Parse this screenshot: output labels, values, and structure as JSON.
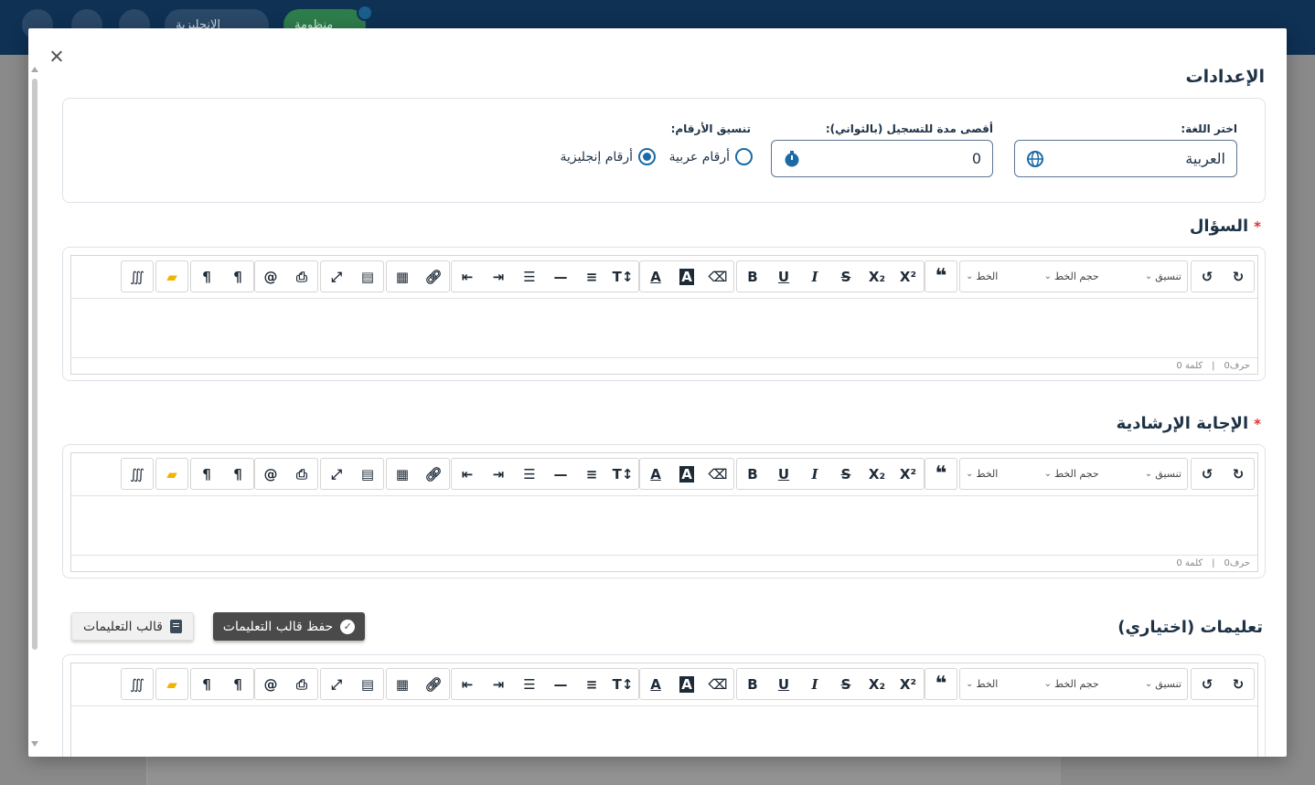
{
  "background": {
    "language_chip": "الإنجليزية",
    "system_chip": "منظومة"
  },
  "modal": {
    "title": "الإعدادات",
    "settings": {
      "language_label": "اختر اللغة:",
      "language_value": "العربية",
      "max_duration_label": "أقصى مدة للتسجيل (بالثواني):",
      "max_duration_value": "0",
      "number_format_label": "تنسيق الأرقام:",
      "number_options": [
        {
          "label": "أرقام عربية",
          "selected": false
        },
        {
          "label": "أرقام إنجليزية",
          "selected": true
        }
      ]
    },
    "sections": {
      "question_label": "السؤال",
      "answer_label": "الإجابة الإرشادية",
      "instructions_label": "تعليمات (اختياري)",
      "required_mark": "*"
    },
    "editor": {
      "format_select": "تنسيق",
      "size_select": "حجم الخط",
      "font_select": "الخط",
      "char_count": "حرف0",
      "word_count": "كلمة 0",
      "separator": "|"
    },
    "buttons": {
      "save_template": "حفظ قالب التعليمات",
      "template": "قالب التعليمات"
    }
  },
  "colors": {
    "topbar": "#0e3154",
    "primary": "#1b6aa5",
    "dark_button": "#4a4a4a",
    "required": "#dd3333"
  }
}
